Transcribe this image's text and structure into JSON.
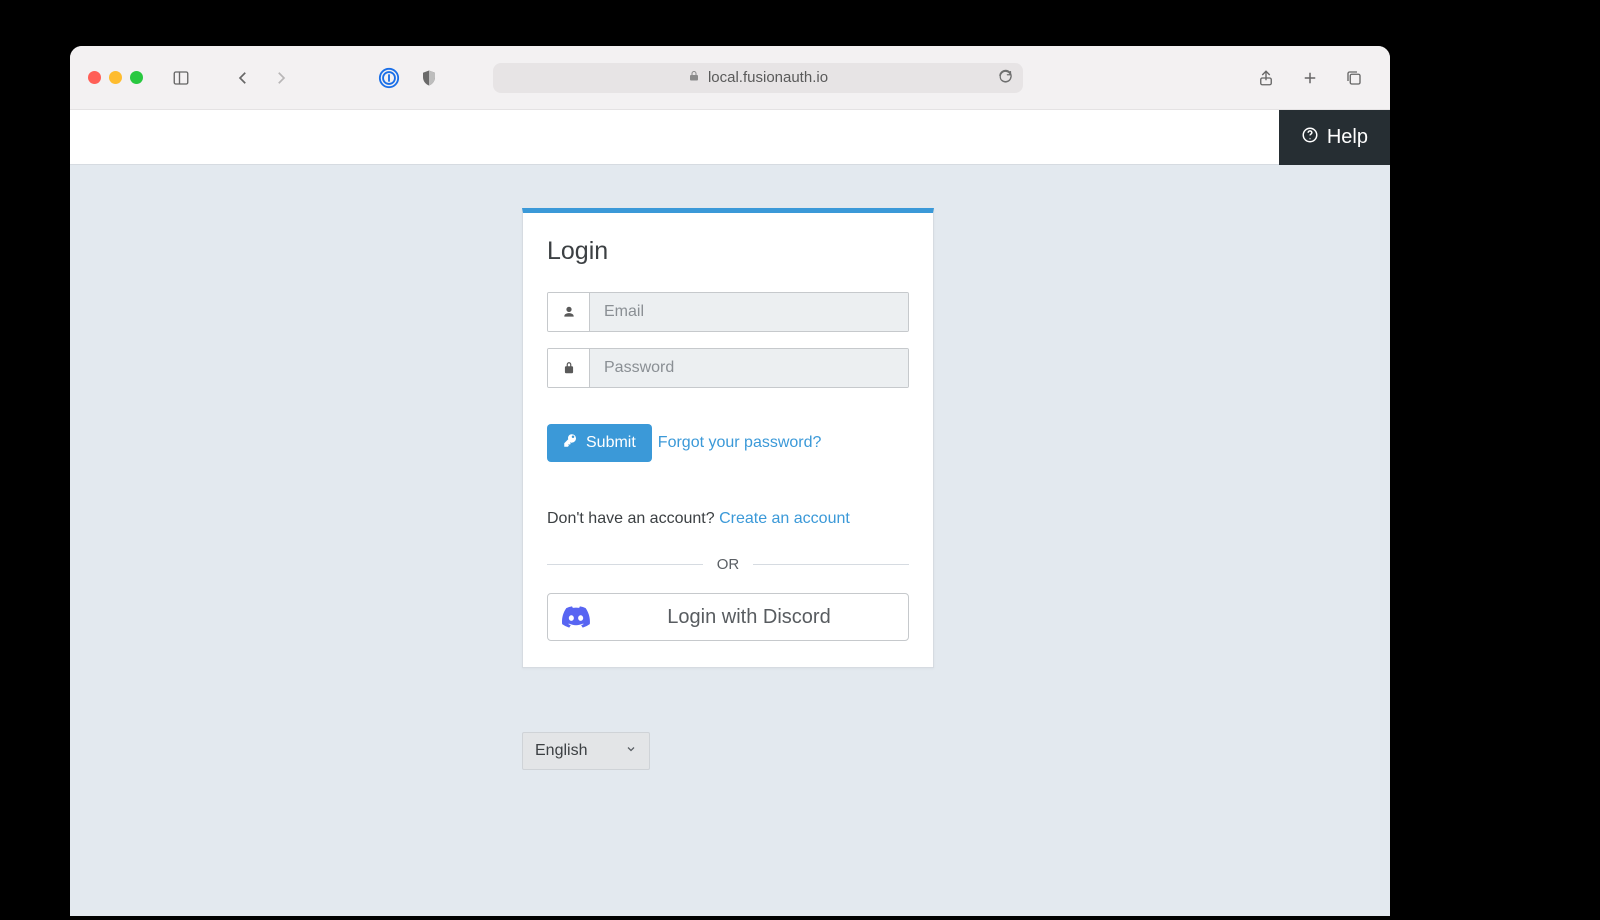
{
  "browser": {
    "url_host": "local.fusionauth.io"
  },
  "topbar": {
    "help_label": "Help"
  },
  "login": {
    "title": "Login",
    "email_placeholder": "Email",
    "password_placeholder": "Password",
    "submit_label": "Submit",
    "forgot_link": "Forgot your password?",
    "no_account_text": "Don't have an account? ",
    "create_account_link": "Create an account",
    "or_label": "OR",
    "oauth_discord_label": "Login with Discord"
  },
  "footer": {
    "language_selected": "English"
  },
  "colors": {
    "accent": "#3b99d8",
    "page_bg": "#e3e9ef",
    "dark_btn": "#262e33",
    "discord": "#5865F2"
  }
}
